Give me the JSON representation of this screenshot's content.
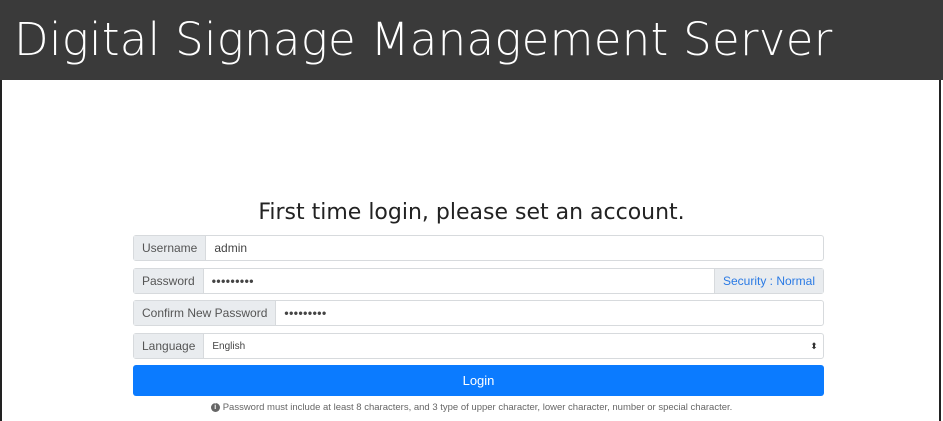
{
  "header": {
    "title": "Digital Signage Management Server"
  },
  "form": {
    "heading": "First time login, please set an account.",
    "username": {
      "label": "Username",
      "value": "admin"
    },
    "password": {
      "label": "Password",
      "value": "•••••••••",
      "strength": "Security : Normal"
    },
    "confirm": {
      "label": "Confirm New Password",
      "value": "•••••••••"
    },
    "language": {
      "label": "Language",
      "selected": "English",
      "caret": "⬍"
    },
    "login_label": "Login",
    "note": "Password must include at least 8 characters, and 3 type of upper character, lower character, number or special character.",
    "note_icon": "info-icon"
  },
  "colors": {
    "header_bg": "#3a3a3a",
    "primary": "#0b7bff",
    "link": "#2a7ae4"
  }
}
